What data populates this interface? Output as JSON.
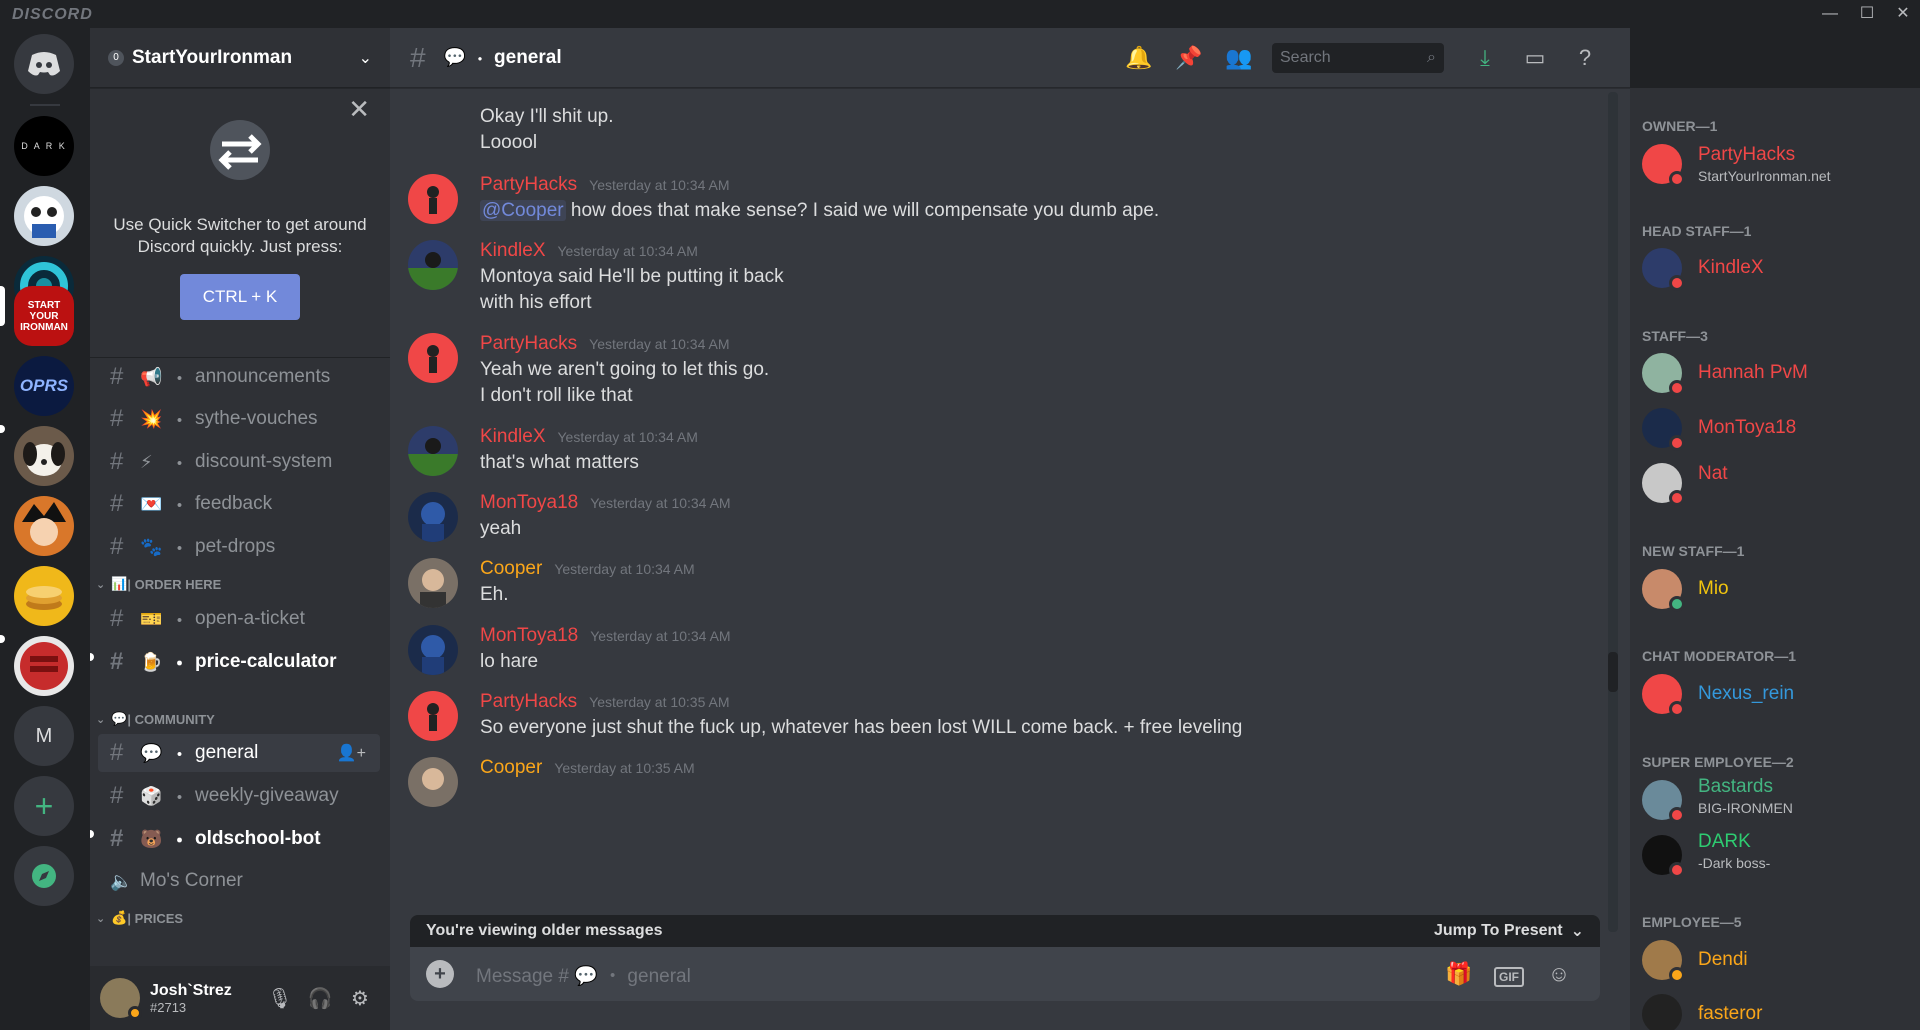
{
  "app": {
    "brand": "DISCORD"
  },
  "window": {
    "minimize": "—",
    "maximize": "☐",
    "close": "✕"
  },
  "guilds": {
    "home_label": "Discord",
    "dark_label": "D A R K",
    "syi_label": "START YOUR IRONMAN",
    "oprs_label": "OPRS",
    "m_label": "M",
    "add_label": "+",
    "explore_label": "⌭"
  },
  "server": {
    "name": "StartYourIronman",
    "badge": "0"
  },
  "quick_switcher": {
    "text_line1": "Use Quick Switcher to get around",
    "text_line2": "Discord quickly. Just press:",
    "button": "CTRL + K"
  },
  "channels": [
    {
      "name": "announcements",
      "emoji": "📢"
    },
    {
      "name": "sythe-vouches",
      "emoji": "💥"
    },
    {
      "name": "discount-system",
      "emoji": "⚡"
    },
    {
      "name": "feedback",
      "emoji": "💌"
    },
    {
      "name": "pet-drops",
      "emoji": "🐾"
    }
  ],
  "cat_order": {
    "name": "| ORDER HERE",
    "emoji": "📊"
  },
  "order_channels": [
    {
      "name": "open-a-ticket",
      "emoji": "🎫"
    },
    {
      "name": "price-calculator",
      "emoji": "🍺"
    }
  ],
  "cat_community": {
    "name": "| COMMUNITY",
    "emoji": "💬"
  },
  "community_channels": [
    {
      "name": "general",
      "emoji": "💬"
    },
    {
      "name": "weekly-giveaway",
      "emoji": "🎲"
    },
    {
      "name": "oldschool-bot",
      "emoji": "🐻"
    }
  ],
  "voice_channel": {
    "name": "Mo's Corner",
    "icon": "🔈"
  },
  "cat_prices": {
    "name": "| PRICES",
    "emoji": "💰"
  },
  "user": {
    "name": "Josh`Strez",
    "tag": "#2713"
  },
  "chat": {
    "channel": "general",
    "channel_emoji": "💬",
    "search_placeholder": "Search",
    "older_text": "You're viewing older messages",
    "jump_text": "Jump To Present",
    "composer_placeholder": "Message # 💬 ・ general"
  },
  "messages": {
    "top_line1": "Okay I'll shit up.",
    "top_line2": "Looool",
    "m1": {
      "author": "PartyHacks",
      "time": "Yesterday at 10:34 AM",
      "mention": "@Cooper",
      "text": " how does that make sense? I said we will compensate you dumb ape."
    },
    "m2": {
      "author": "KindleX",
      "time": "Yesterday at 10:34 AM",
      "line1": "Montoya said He'll be putting it back",
      "line2": "with his effort"
    },
    "m3": {
      "author": "PartyHacks",
      "time": "Yesterday at 10:34 AM",
      "line1": "Yeah we aren't going to let this go.",
      "line2": "I don't roll like that"
    },
    "m4": {
      "author": "KindleX",
      "time": "Yesterday at 10:34 AM",
      "line1": "that's what matters"
    },
    "m5": {
      "author": "MonToya18",
      "time": "Yesterday at 10:34 AM",
      "line1": "yeah"
    },
    "m6": {
      "author": "Cooper",
      "time": "Yesterday at 10:34 AM",
      "line1": "Eh."
    },
    "m7": {
      "author": "MonToya18",
      "time": "Yesterday at 10:34 AM",
      "line1": "lo hare"
    },
    "m8": {
      "author": "PartyHacks",
      "time": "Yesterday at 10:35 AM",
      "line1": "So everyone just shut the fuck up, whatever has been lost WILL come back. + free leveling"
    },
    "m9": {
      "author": "Cooper",
      "time": "Yesterday at 10:35 AM"
    }
  },
  "members": {
    "owner": {
      "role": "OWNER—1",
      "name": "PartyHacks",
      "sub": "StartYourIronman.net"
    },
    "head": {
      "role": "HEAD STAFF—1",
      "name": "KindleX"
    },
    "staff": {
      "role": "STAFF—3",
      "m1": "Hannah PvM",
      "m2": "MonToya18",
      "m3": "Nat"
    },
    "newstaff": {
      "role": "NEW STAFF—1",
      "name": "Mio"
    },
    "chatmod": {
      "role": "CHAT MODERATOR—1",
      "name": "Nexus_rein"
    },
    "super": {
      "role": "SUPER EMPLOYEE—2",
      "m1": "Bastards",
      "m1_sub": "BIG-IRONMEN",
      "m2": "DARK",
      "m2_sub": "-Dark boss-"
    },
    "employee": {
      "role": "EMPLOYEE—5",
      "m1": "Dendi",
      "m2": "fasteror"
    }
  },
  "colors": {
    "red": "#f04747",
    "orange": "#faa61a",
    "yellow": "#f1c40f",
    "blue": "#3498db",
    "green": "#43b581",
    "darkgreen": "#2ecc71",
    "blurple": "#7289da"
  }
}
